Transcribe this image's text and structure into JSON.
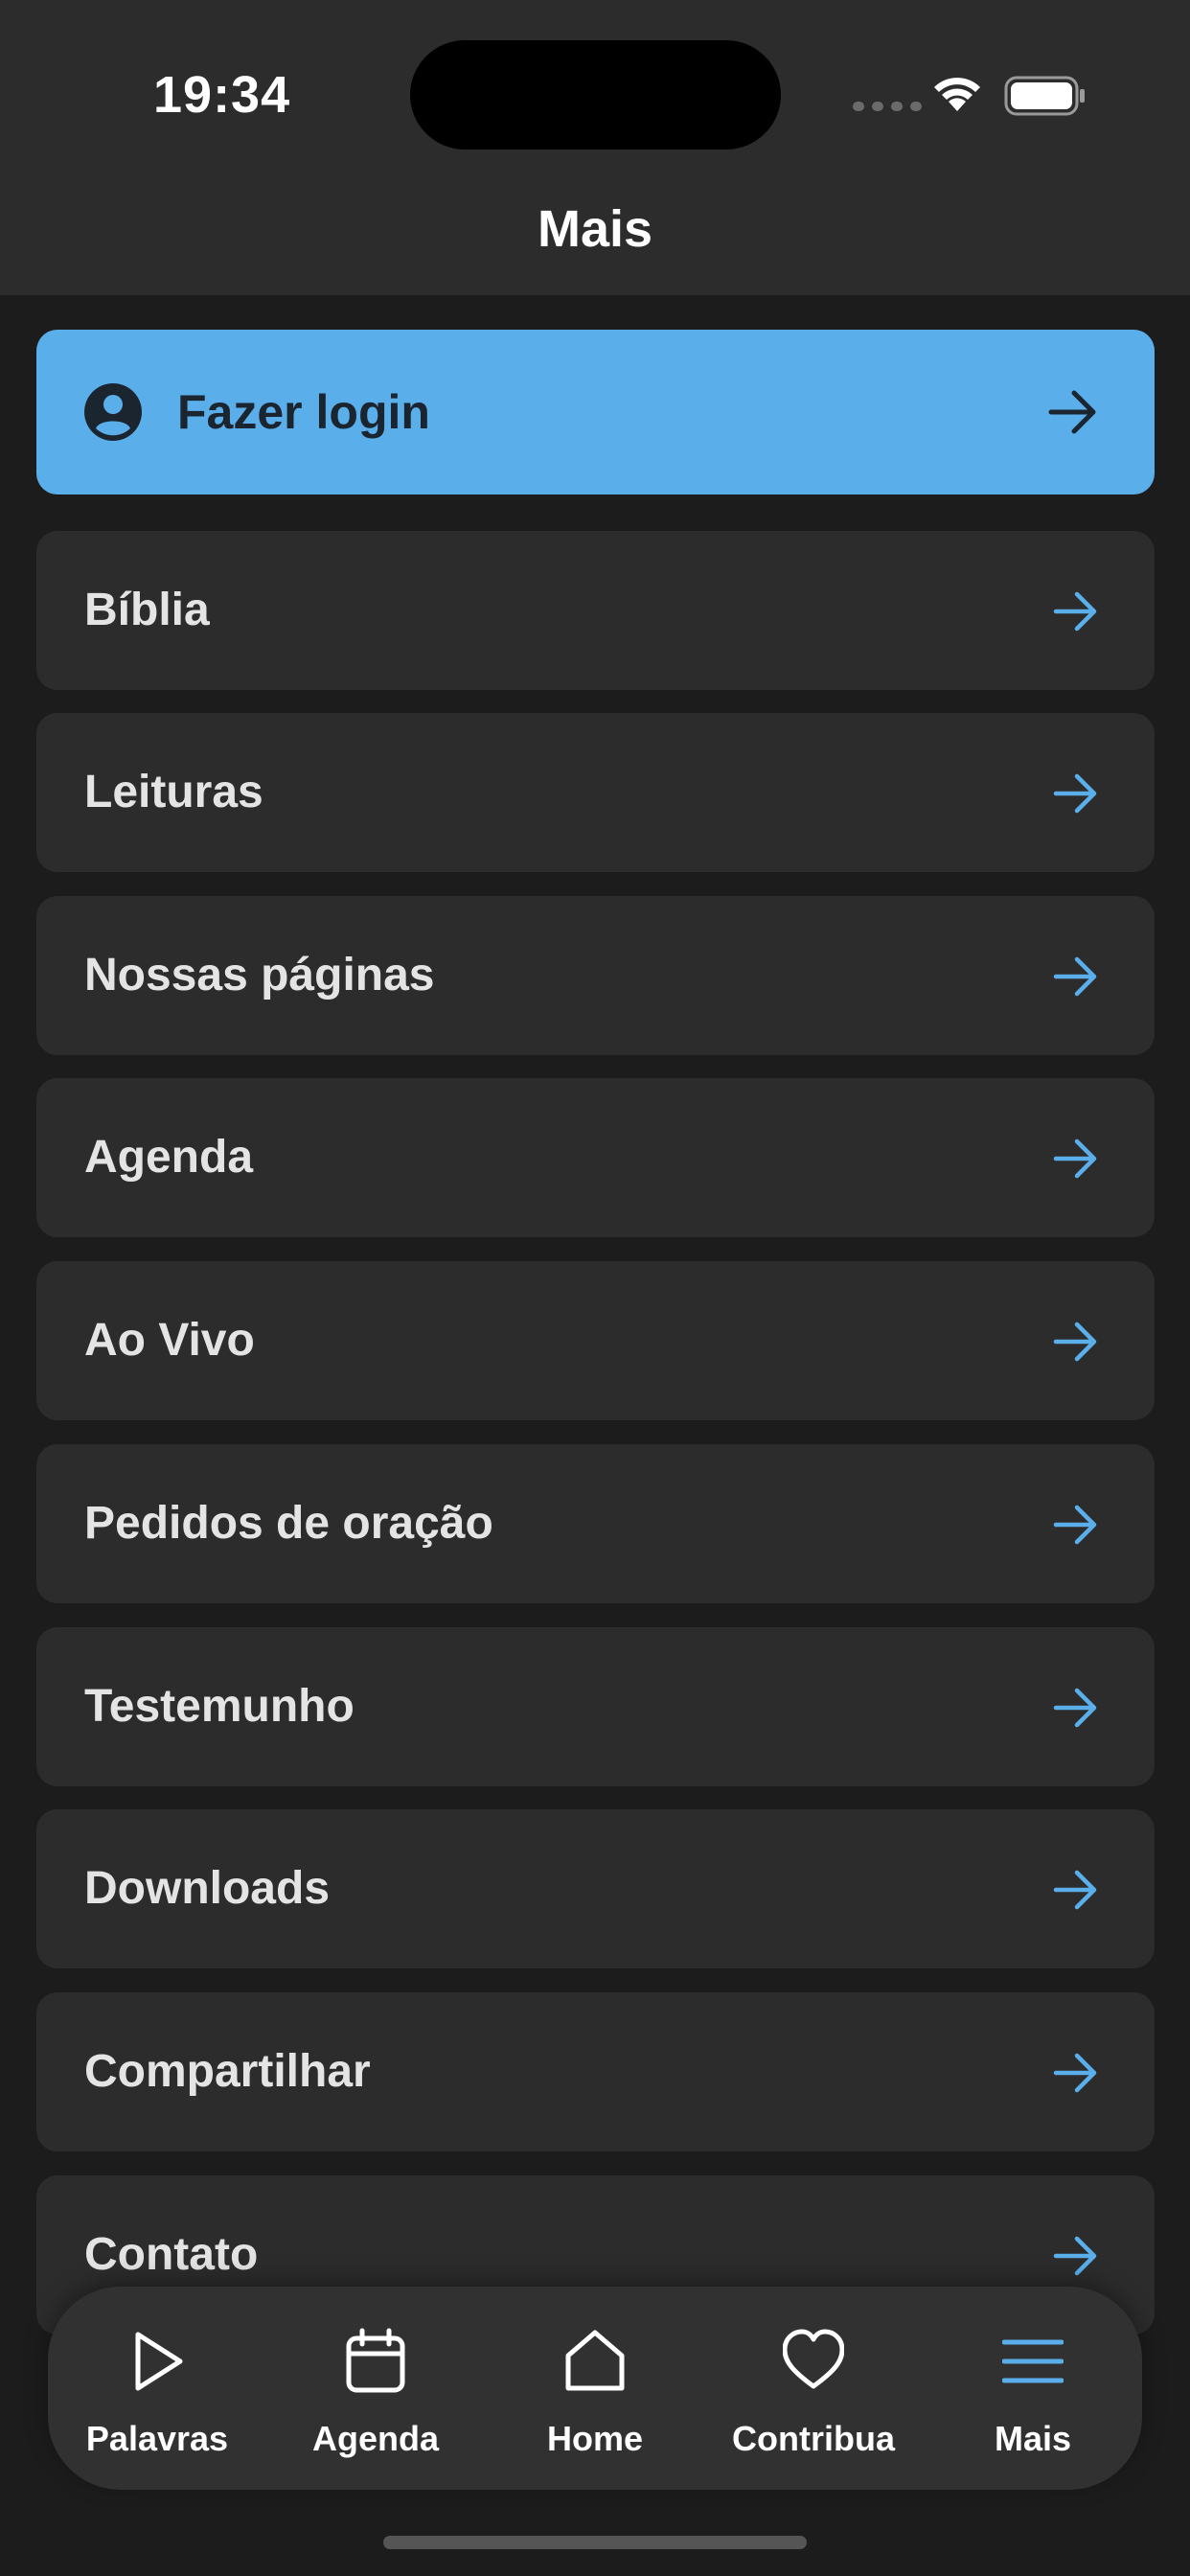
{
  "status_bar": {
    "time": "19:34"
  },
  "header": {
    "title": "Mais"
  },
  "login": {
    "label": "Fazer login"
  },
  "menu": {
    "items": [
      {
        "label": "Bíblia"
      },
      {
        "label": "Leituras"
      },
      {
        "label": "Nossas páginas"
      },
      {
        "label": "Agenda"
      },
      {
        "label": "Ao Vivo"
      },
      {
        "label": "Pedidos de oração"
      },
      {
        "label": "Testemunho"
      },
      {
        "label": "Downloads"
      },
      {
        "label": "Compartilhar"
      },
      {
        "label": "Contato"
      }
    ]
  },
  "tabbar": {
    "tabs": [
      {
        "label": "Palavras",
        "icon": "play-icon"
      },
      {
        "label": "Agenda",
        "icon": "calendar-icon"
      },
      {
        "label": "Home",
        "icon": "home-icon"
      },
      {
        "label": "Contribua",
        "icon": "heart-icon"
      },
      {
        "label": "Mais",
        "icon": "menu-icon",
        "active": true
      }
    ]
  },
  "colors": {
    "accent": "#5aaeea",
    "background": "#1c1c1c",
    "card": "#2c2c2c"
  }
}
